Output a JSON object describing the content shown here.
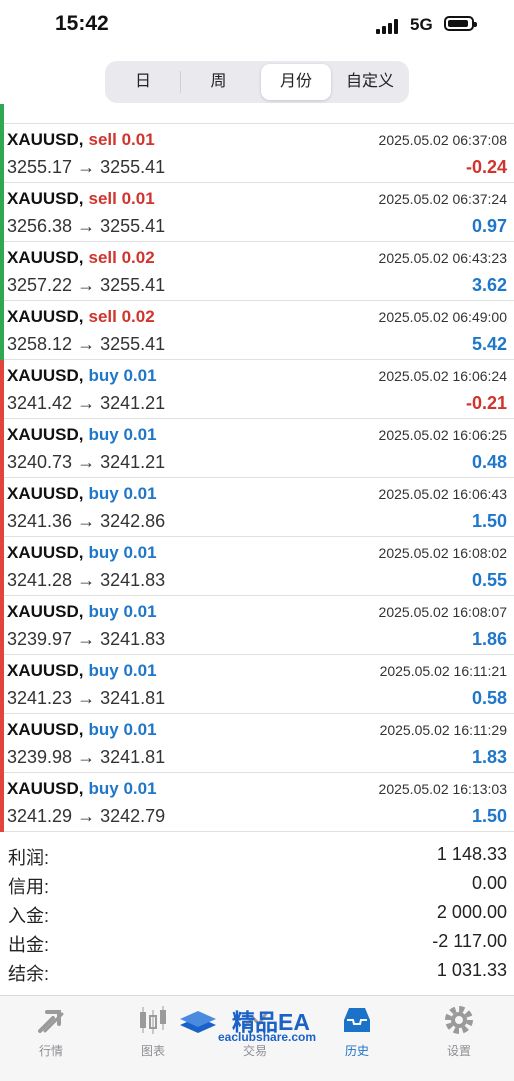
{
  "status_bar": {
    "time": "15:42",
    "network": "5G"
  },
  "period_tabs": [
    {
      "label": "日",
      "active": false
    },
    {
      "label": "周",
      "active": false
    },
    {
      "label": "月份",
      "active": true
    },
    {
      "label": "自定义",
      "active": false
    }
  ],
  "colors": {
    "sell": "#d0342c",
    "buy": "#1f77c9",
    "loss": "#d0342c",
    "gain": "#1f77c9",
    "sell_bar": "#2fa84f",
    "buy_bar": "#e0443c"
  },
  "trades": [
    {
      "symbol": "XAUUSD,",
      "side": "sell 0.01",
      "type": "sell",
      "datetime": "2025.05.02 06:37:08",
      "prices": "3255.17 → 3255.41",
      "profit": "-0.24",
      "profit_sign": "loss"
    },
    {
      "symbol": "XAUUSD,",
      "side": "sell 0.01",
      "type": "sell",
      "datetime": "2025.05.02 06:37:24",
      "prices": "3256.38 → 3255.41",
      "profit": "0.97",
      "profit_sign": "gain"
    },
    {
      "symbol": "XAUUSD,",
      "side": "sell 0.02",
      "type": "sell",
      "datetime": "2025.05.02 06:43:23",
      "prices": "3257.22 → 3255.41",
      "profit": "3.62",
      "profit_sign": "gain"
    },
    {
      "symbol": "XAUUSD,",
      "side": "sell 0.02",
      "type": "sell",
      "datetime": "2025.05.02 06:49:00",
      "prices": "3258.12 → 3255.41",
      "profit": "5.42",
      "profit_sign": "gain"
    },
    {
      "symbol": "XAUUSD,",
      "side": "buy 0.01",
      "type": "buy",
      "datetime": "2025.05.02 16:06:24",
      "prices": "3241.42 → 3241.21",
      "profit": "-0.21",
      "profit_sign": "loss"
    },
    {
      "symbol": "XAUUSD,",
      "side": "buy 0.01",
      "type": "buy",
      "datetime": "2025.05.02 16:06:25",
      "prices": "3240.73 → 3241.21",
      "profit": "0.48",
      "profit_sign": "gain"
    },
    {
      "symbol": "XAUUSD,",
      "side": "buy 0.01",
      "type": "buy",
      "datetime": "2025.05.02 16:06:43",
      "prices": "3241.36 → 3242.86",
      "profit": "1.50",
      "profit_sign": "gain"
    },
    {
      "symbol": "XAUUSD,",
      "side": "buy 0.01",
      "type": "buy",
      "datetime": "2025.05.02 16:08:02",
      "prices": "3241.28 → 3241.83",
      "profit": "0.55",
      "profit_sign": "gain"
    },
    {
      "symbol": "XAUUSD,",
      "side": "buy 0.01",
      "type": "buy",
      "datetime": "2025.05.02 16:08:07",
      "prices": "3239.97 → 3241.83",
      "profit": "1.86",
      "profit_sign": "gain"
    },
    {
      "symbol": "XAUUSD,",
      "side": "buy 0.01",
      "type": "buy",
      "datetime": "2025.05.02 16:11:21",
      "prices": "3241.23 → 3241.81",
      "profit": "0.58",
      "profit_sign": "gain"
    },
    {
      "symbol": "XAUUSD,",
      "side": "buy 0.01",
      "type": "buy",
      "datetime": "2025.05.02 16:11:29",
      "prices": "3239.98 → 3241.81",
      "profit": "1.83",
      "profit_sign": "gain"
    },
    {
      "symbol": "XAUUSD,",
      "side": "buy 0.01",
      "type": "buy",
      "datetime": "2025.05.02 16:13:03",
      "prices": "3241.29 → 3242.79",
      "profit": "1.50",
      "profit_sign": "gain"
    }
  ],
  "summary": [
    {
      "label": "利润:",
      "value": "1 148.33"
    },
    {
      "label": "信用:",
      "value": "0.00"
    },
    {
      "label": "入金:",
      "value": "2 000.00"
    },
    {
      "label": "出金:",
      "value": "-2 117.00"
    },
    {
      "label": "结余:",
      "value": "1 031.33"
    }
  ],
  "tabbar": [
    {
      "label": "行情",
      "icon": "quotes-icon",
      "active": false
    },
    {
      "label": "图表",
      "icon": "chart-icon",
      "active": false
    },
    {
      "label": "交易",
      "icon": "trade-icon",
      "active": false
    },
    {
      "label": "历史",
      "icon": "history-icon",
      "active": true
    },
    {
      "label": "设置",
      "icon": "settings-icon",
      "active": false
    }
  ],
  "watermark": {
    "title": "精品EA",
    "url": "eaclubshare.com"
  }
}
